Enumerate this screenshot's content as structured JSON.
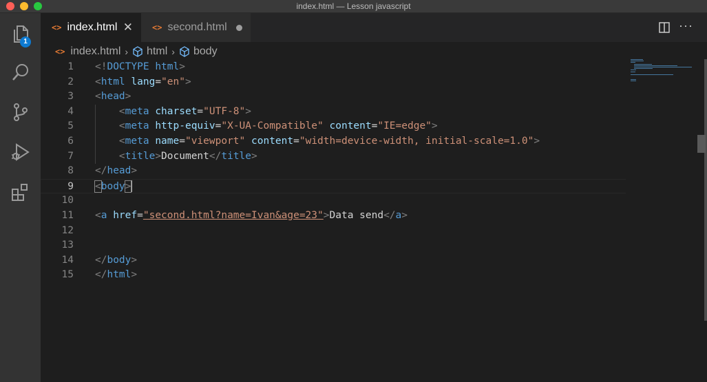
{
  "window": {
    "title": "index.html — Lesson javascript"
  },
  "activity_bar": {
    "items": [
      {
        "icon": "files-icon",
        "badge": "1"
      },
      {
        "icon": "search-icon"
      },
      {
        "icon": "source-control-icon"
      },
      {
        "icon": "debug-icon"
      },
      {
        "icon": "extensions-icon"
      }
    ]
  },
  "tabs": [
    {
      "label": "index.html",
      "icon": "html-file-icon",
      "icon_glyph": "<>",
      "active": true,
      "close": "✕"
    },
    {
      "label": "second.html",
      "icon": "html-file-icon",
      "icon_glyph": "<>",
      "active": false,
      "dirty": true
    }
  ],
  "editor_actions": {
    "more": "···"
  },
  "breadcrumb": {
    "file": "index.html",
    "file_glyph": "<>",
    "separator": "›",
    "items": [
      "html",
      "body"
    ]
  },
  "editor": {
    "current_line": 9,
    "lines": [
      {
        "num": "1",
        "text": "<!DOCTYPE html>"
      },
      {
        "num": "2",
        "text": "<html lang=\"en\">"
      },
      {
        "num": "3",
        "text": "<head>"
      },
      {
        "num": "4",
        "text": "    <meta charset=\"UTF-8\">"
      },
      {
        "num": "5",
        "text": "    <meta http-equiv=\"X-UA-Compatible\" content=\"IE=edge\">"
      },
      {
        "num": "6",
        "text": "    <meta name=\"viewport\" content=\"width=device-width, initial-scale=1.0\">"
      },
      {
        "num": "7",
        "text": "    <title>Document</title>"
      },
      {
        "num": "8",
        "text": "</head>"
      },
      {
        "num": "9",
        "text": "<body>"
      },
      {
        "num": "10",
        "text": ""
      },
      {
        "num": "11",
        "text": "<a href=\"second.html?name=Ivan&age=23\">Data send</a>"
      },
      {
        "num": "12",
        "text": ""
      },
      {
        "num": "13",
        "text": ""
      },
      {
        "num": "14",
        "text": "</body>"
      },
      {
        "num": "15",
        "text": "</html>"
      }
    ]
  },
  "colors": {
    "tag": "#569cd6",
    "punctuation": "#808080",
    "attribute": "#9cdcfe",
    "string": "#ce9178",
    "text": "#d4d4d4",
    "file_icon": "#e37933",
    "badge": "#0e7ad1"
  }
}
